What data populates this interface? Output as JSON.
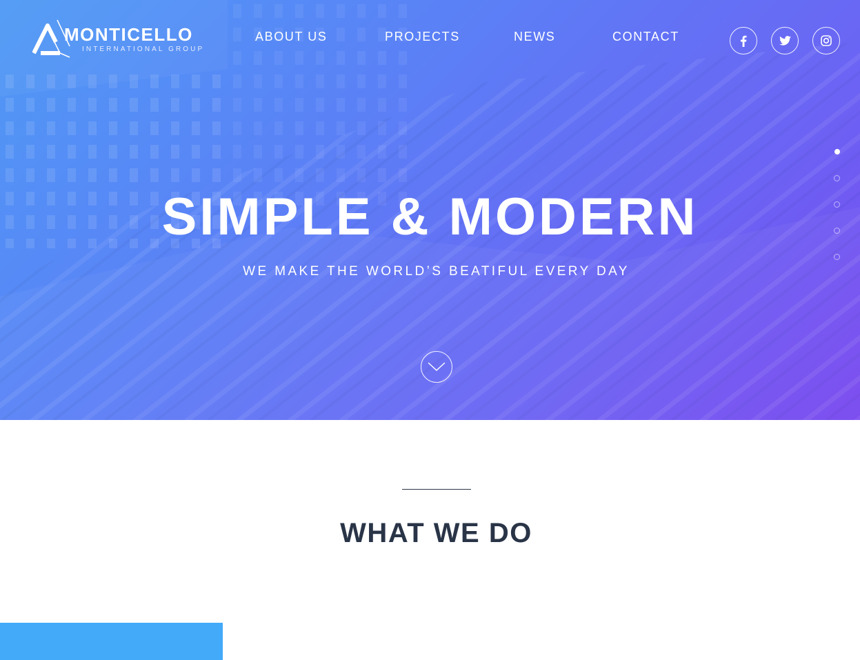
{
  "brand": {
    "name": "MONTICELLO",
    "tagline": "INTERNATIONAL GROUP"
  },
  "nav": {
    "items": [
      {
        "label": "ABOUT US"
      },
      {
        "label": "PROJECTS"
      },
      {
        "label": "NEWS"
      },
      {
        "label": "CONTACT"
      }
    ]
  },
  "social": {
    "items": [
      {
        "icon": "facebook-icon"
      },
      {
        "icon": "twitter-icon"
      },
      {
        "icon": "instagram-icon"
      }
    ]
  },
  "slider": {
    "slide_count": 5,
    "active_index": 0
  },
  "hero": {
    "title": "SIMPLE & MODERN",
    "subtitle": "WE MAKE THE WORLD’S BEATIFUL EVERY DAY",
    "scroll_icon": "chevron-down-icon"
  },
  "section": {
    "title": "WHAT WE DO"
  },
  "colors": {
    "hero_gradient_start": "#4f9af5",
    "hero_gradient_end": "#7847ef",
    "heading": "#293447",
    "accent_block": "#42aaf9"
  }
}
